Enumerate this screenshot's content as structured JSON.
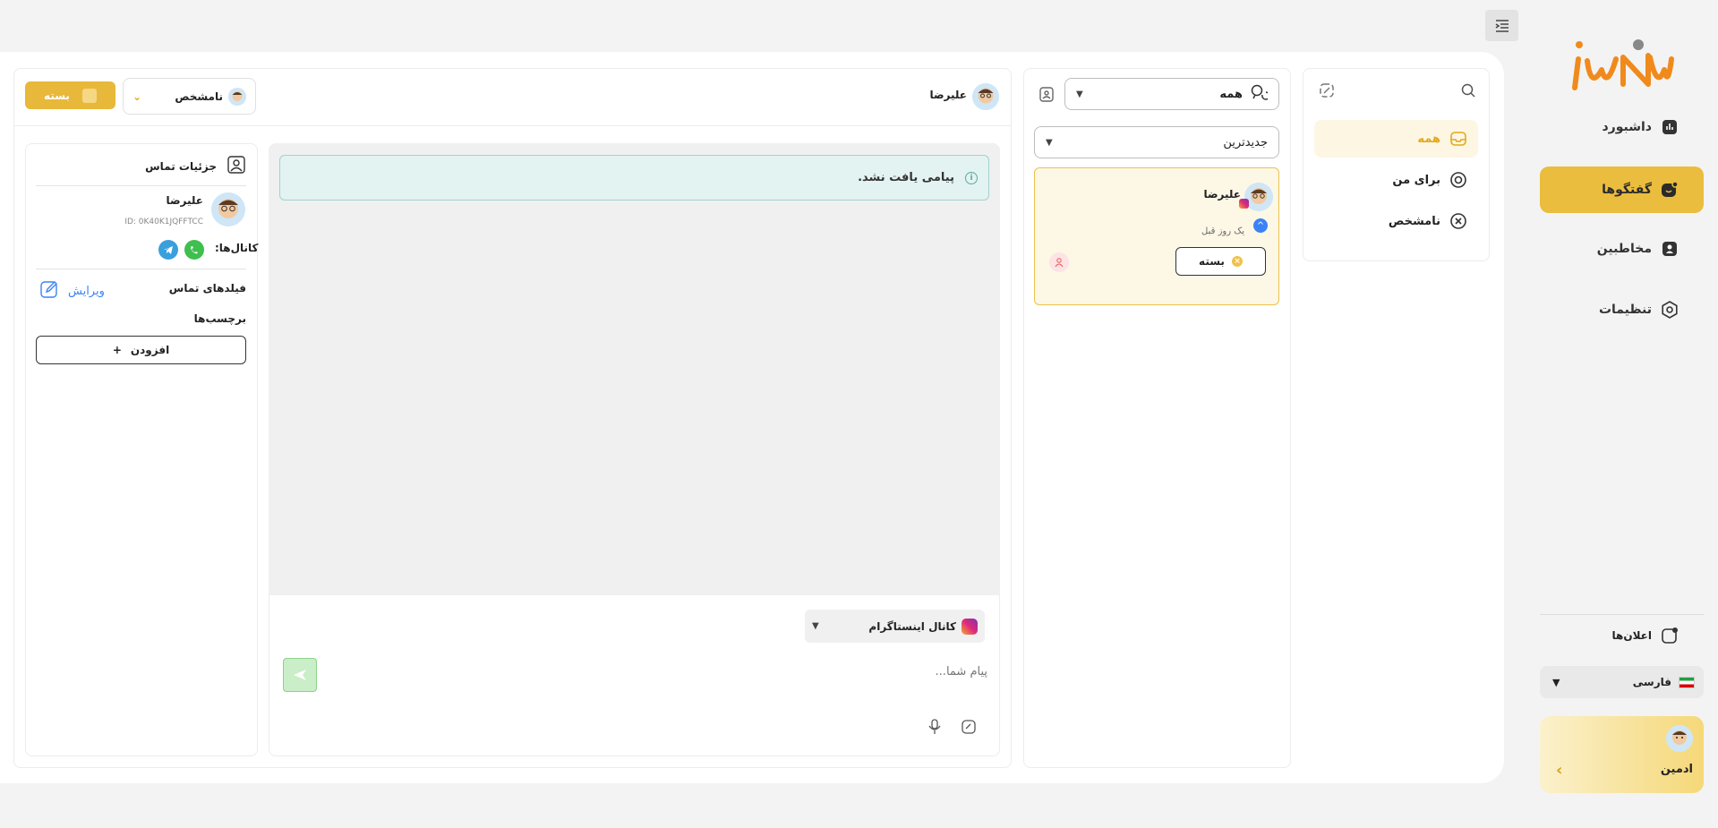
{
  "brand": {
    "logo_text": "iWN"
  },
  "sidebar": {
    "items": [
      {
        "label": "داشبورد",
        "icon": "chart-icon",
        "active": false
      },
      {
        "label": "گفتگوها",
        "icon": "chat-icon",
        "active": true
      },
      {
        "label": "مخاطبین",
        "icon": "contacts-icon",
        "active": false
      },
      {
        "label": "تنظیمات",
        "icon": "settings-icon",
        "active": false
      }
    ],
    "announcements": "اعلان‌ها",
    "language": "فارسی",
    "profile_name": "ادمین"
  },
  "filters": {
    "items": [
      {
        "label": "همه",
        "icon": "inbox-icon",
        "active": true
      },
      {
        "label": "برای من",
        "icon": "at-icon",
        "active": false
      },
      {
        "label": "نامشخص",
        "icon": "close-circle-icon",
        "active": false
      }
    ]
  },
  "list": {
    "scope_select": "همه",
    "sort_select": "جدیدترین",
    "conversations": [
      {
        "name": "علیرضا",
        "time": "یک روز قبل",
        "status": "بسته"
      }
    ]
  },
  "chat": {
    "contact_name": "علیرضا",
    "assignee": "نامشخص",
    "status_button": "بسته",
    "empty_message": "پیامی یافت نشد.",
    "channel": "کانال اینستاگرام",
    "input_placeholder": "پیام شما..."
  },
  "contact": {
    "title": "جزئیات تماس",
    "name": "علیرضا",
    "id_text": "ID: 0K40K1JQFFTCC",
    "channels_label": "کانال‌ها:",
    "fields_label": "فیلدهای تماس",
    "edit_label": "ویرایش",
    "tags_label": "برچسب‌ها",
    "add_label": "افزودن"
  },
  "colors": {
    "accent": "#ebbd3e",
    "brand_orange": "#f08a1c",
    "alert_bg": "#e3f3f1"
  }
}
